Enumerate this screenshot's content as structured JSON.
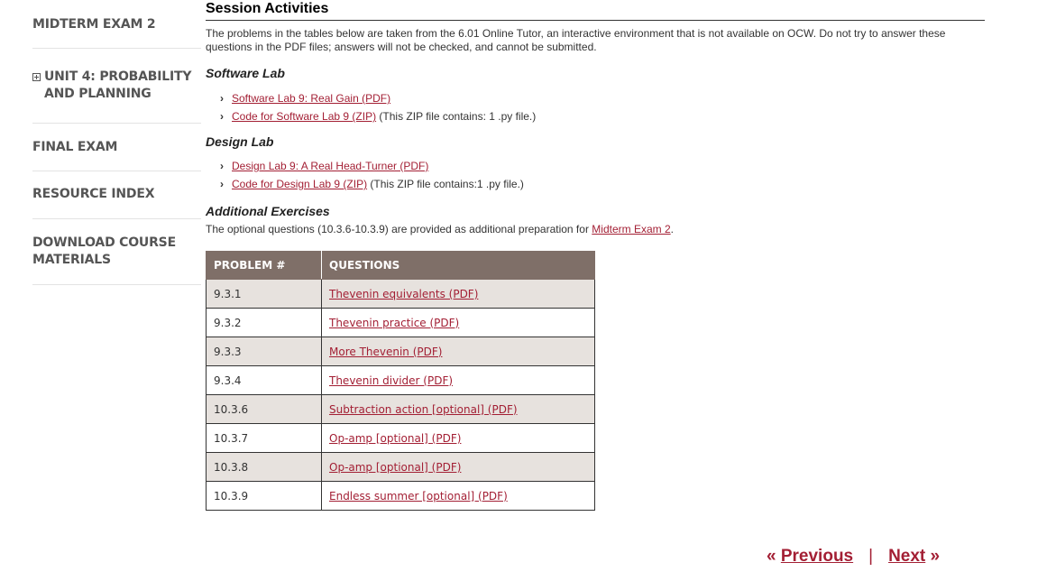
{
  "sidebar": {
    "items": [
      {
        "label": "MIDTERM EXAM 2"
      },
      {
        "label": "UNIT 4: PROBABILITY AND PLANNING"
      },
      {
        "label": "FINAL EXAM"
      },
      {
        "label": "RESOURCE INDEX"
      },
      {
        "label": "DOWNLOAD COURSE MATERIALS"
      }
    ]
  },
  "main": {
    "title": "Session Activities",
    "intro": "The problems in the tables below are taken from the 6.01 Online Tutor, an interactive environment that is not available on OCW. Do not try to answer these questions in the PDF files; answers will not be checked, and cannot be submitted.",
    "software_lab": {
      "heading": "Software Lab",
      "links": [
        {
          "text": "Software Lab 9: Real Gain (PDF)",
          "note": ""
        },
        {
          "text": "Code for Software Lab 9 (ZIP)",
          "note": " (This ZIP file contains: 1 .py file.)"
        }
      ]
    },
    "design_lab": {
      "heading": "Design Lab",
      "links": [
        {
          "text": "Design Lab 9: A Real Head-Turner (PDF)",
          "note": ""
        },
        {
          "text": "Code for Design Lab 9 (ZIP)",
          "note": " (This ZIP file contains:1 .py file.)"
        }
      ]
    },
    "additional": {
      "heading": "Additional Exercises",
      "text_before": "The optional questions (10.3.6-10.3.9) are provided as additional preparation for ",
      "link": "Midterm Exam 2",
      "text_after": "."
    },
    "table": {
      "headers": [
        "PROBLEM #",
        "QUESTIONS"
      ],
      "rows": [
        {
          "problem": "9.3.1",
          "question": "Thevenin equivalents (PDF)"
        },
        {
          "problem": "9.3.2",
          "question": "Thevenin practice (PDF)"
        },
        {
          "problem": "9.3.3",
          "question": "More Thevenin (PDF)"
        },
        {
          "problem": "9.3.4",
          "question": "Thevenin divider (PDF)"
        },
        {
          "problem": "10.3.6",
          "question": "Subtraction action [optional] (PDF)"
        },
        {
          "problem": "10.3.7",
          "question": "Op-amp [optional] (PDF)"
        },
        {
          "problem": "10.3.8",
          "question": "Op-amp [optional] (PDF)"
        },
        {
          "problem": "10.3.9",
          "question": "Endless summer [optional] (PDF)"
        }
      ]
    }
  },
  "pager": {
    "prev_symbol": "«",
    "prev_label": "Previous",
    "separator": "|",
    "next_label": "Next",
    "next_symbol": "»"
  },
  "colors": {
    "link": "#a31f34",
    "table_header": "#7f6f68",
    "row_shade": "#e7e2de"
  }
}
